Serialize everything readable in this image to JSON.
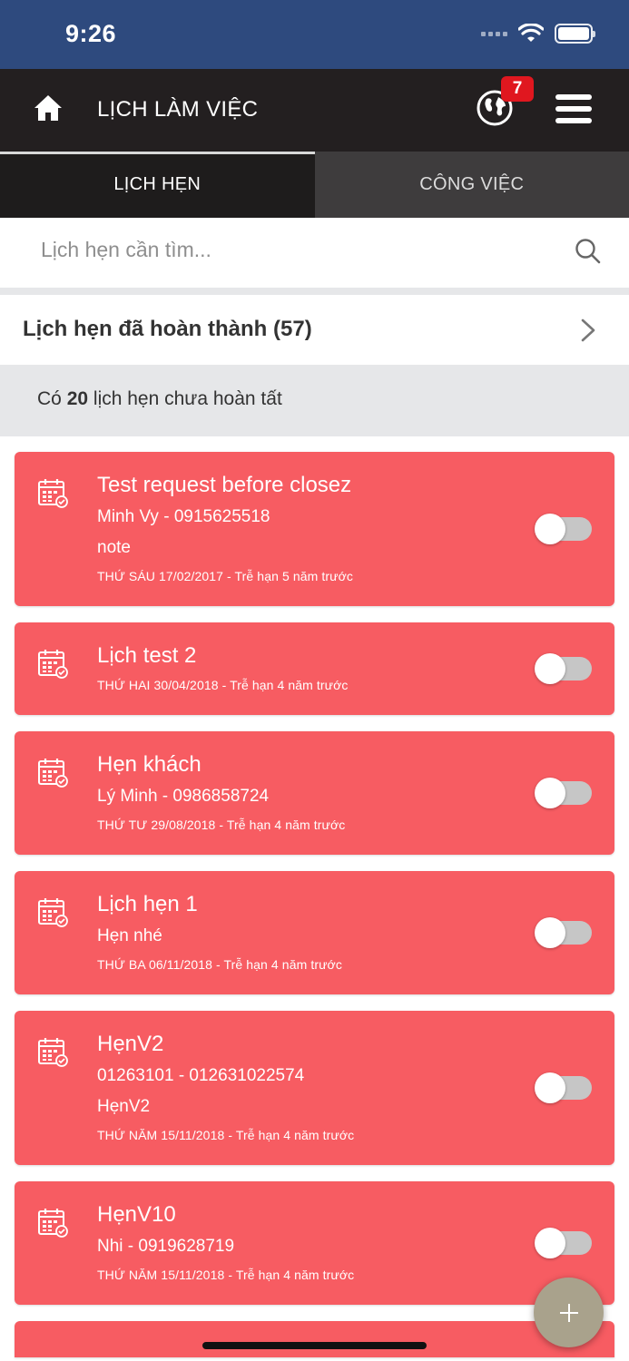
{
  "status_bar": {
    "time": "9:26"
  },
  "header": {
    "title": "LỊCH LÀM VIỆC",
    "notification_count": "7",
    "icons": [
      "home-icon",
      "globe-icon",
      "hamburger-menu-icon"
    ]
  },
  "tabs": [
    {
      "label": "LỊCH HẸN",
      "active": true
    },
    {
      "label": "CÔNG VIỆC",
      "active": false
    }
  ],
  "search": {
    "placeholder": "Lịch hẹn cần tìm..."
  },
  "completed": {
    "label": "Lịch hẹn đã hoàn thành (57)"
  },
  "pending": {
    "prefix": "Có",
    "count": "20",
    "suffix": "lịch hẹn chưa hoàn tất"
  },
  "appointments": [
    {
      "title": "Test request before closez",
      "lines": [
        "Minh Vy - 0915625518",
        "note"
      ],
      "date": "THỨ SÁU 17/02/2017 - Trễ hạn 5 năm trước",
      "done": false
    },
    {
      "title": "Lịch test 2",
      "lines": [],
      "date": "THỨ HAI 30/04/2018 - Trễ hạn 4 năm trước",
      "done": false
    },
    {
      "title": "Hẹn khách",
      "lines": [
        "Lý Minh - 0986858724"
      ],
      "date": "THỨ TƯ 29/08/2018 - Trễ hạn 4 năm trước",
      "done": false
    },
    {
      "title": "Lịch hẹn 1",
      "lines": [
        "Hẹn nhé"
      ],
      "date": "THỨ BA 06/11/2018 - Trễ hạn 4 năm trước",
      "done": false
    },
    {
      "title": "HẹnV2",
      "lines": [
        "01263101 - 012631022574",
        "HẹnV2"
      ],
      "date": "THỨ NĂM 15/11/2018 - Trễ hạn 4 năm trước",
      "done": false
    },
    {
      "title": "HẹnV10",
      "lines": [
        "Nhi - 0919628719"
      ],
      "date": "THỨ NĂM 15/11/2018 - Trễ hạn 4 năm trước",
      "done": false
    }
  ],
  "colors": {
    "status_bar": "#2e4a7e",
    "header": "#231f20",
    "card": "#f75c62",
    "badge": "#e0171f",
    "fab": "#a9a28c"
  }
}
